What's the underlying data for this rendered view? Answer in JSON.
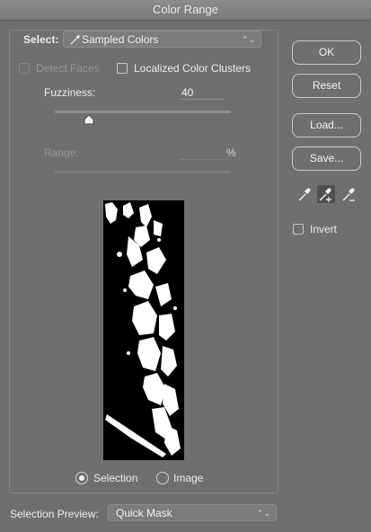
{
  "window": {
    "title": "Color Range"
  },
  "select": {
    "label": "Select:",
    "value": "Sampled Colors",
    "icon": "eyedropper-icon"
  },
  "options": {
    "detect_faces": {
      "label": "Detect Faces",
      "checked": false,
      "enabled": false
    },
    "localized_clusters": {
      "label": "Localized Color Clusters",
      "checked": false
    }
  },
  "fuzziness": {
    "label": "Fuzziness:",
    "value": "40",
    "slider_fraction": 0.2
  },
  "range": {
    "label": "Range:",
    "value": "",
    "unit": "%"
  },
  "preview_mode": {
    "options": [
      {
        "label": "Selection",
        "selected": true
      },
      {
        "label": "Image",
        "selected": false
      }
    ]
  },
  "buttons": {
    "ok": "OK",
    "reset": "Reset",
    "load": "Load...",
    "save": "Save..."
  },
  "eyedroppers": [
    "eyedropper-icon",
    "eyedropper-plus-icon",
    "eyedropper-minus-icon"
  ],
  "invert": {
    "label": "Invert",
    "checked": false
  },
  "selection_preview": {
    "label": "Selection Preview:",
    "value": "Quick Mask"
  }
}
